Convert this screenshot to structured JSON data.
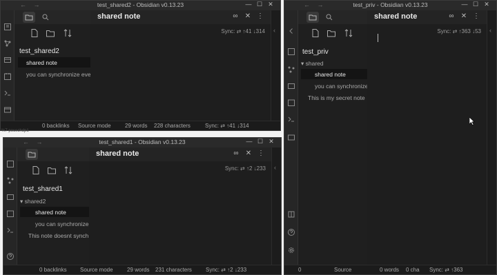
{
  "w1": {
    "title": "test_shared2 - Obsidian v0.13.23",
    "vault": "test_shared2",
    "files": [
      "shared note",
      "you can synchronize eve"
    ],
    "note_title": "shared note",
    "sync_top": "Sync: ⇄ ↑41 ↓314",
    "status": {
      "backlinks": "0 backlinks",
      "mode": "Source mode",
      "words": "29 words",
      "chars": "228 characters",
      "sync": "Sync: ⇄ ↑41 ↓314"
    }
  },
  "w2": {
    "title": "test_shared1 - Obsidian v0.13.23",
    "vault": "test_shared1",
    "folder": "shared2",
    "files": [
      "shared note",
      "you can synchronize",
      "This note doesnt synch"
    ],
    "note_title": "shared note",
    "sync_top": "Sync: ⇄ ↑2 ↓233",
    "status": {
      "backlinks": "0 backlinks",
      "mode": "Source mode",
      "words": "29 words",
      "chars": "231 characters",
      "sync": "Sync: ⇄ ↑2 ↓233"
    }
  },
  "w3": {
    "title": "test_priv - Obsidian v0.13.23",
    "vault": "test_priv",
    "folder": "shared",
    "files": [
      "shared note",
      "you can synchronize",
      "This is my secret note"
    ],
    "note_title": "shared note",
    "sync_top": "Sync: ⇄ ↑363 ↓53",
    "status": {
      "backlinks": "0",
      "mode": "Source",
      "words": "0 words",
      "chars": "0 cha",
      "sync": "Sync: ⇄ ↑363"
    }
  },
  "stray_text": "%7 pouschdp1",
  "icons": {
    "files": "folder-icon",
    "search": "search-icon",
    "new_note": "new-note-icon",
    "new_folder": "new-folder-icon",
    "sort": "sort-icon",
    "reading": "glasses-icon",
    "close": "close-icon",
    "more": "more-options-icon",
    "collapse": "chevron-left-icon"
  },
  "window_controls": {
    "min": "—",
    "max": "☐",
    "close": "✕"
  },
  "nav_arrows": "← →",
  "colors": {
    "bg": "#1e1e1e",
    "sidebar": "#1f1f1f",
    "active_item": "#141414",
    "text": "#dddddd",
    "muted": "#9a9a9a"
  }
}
